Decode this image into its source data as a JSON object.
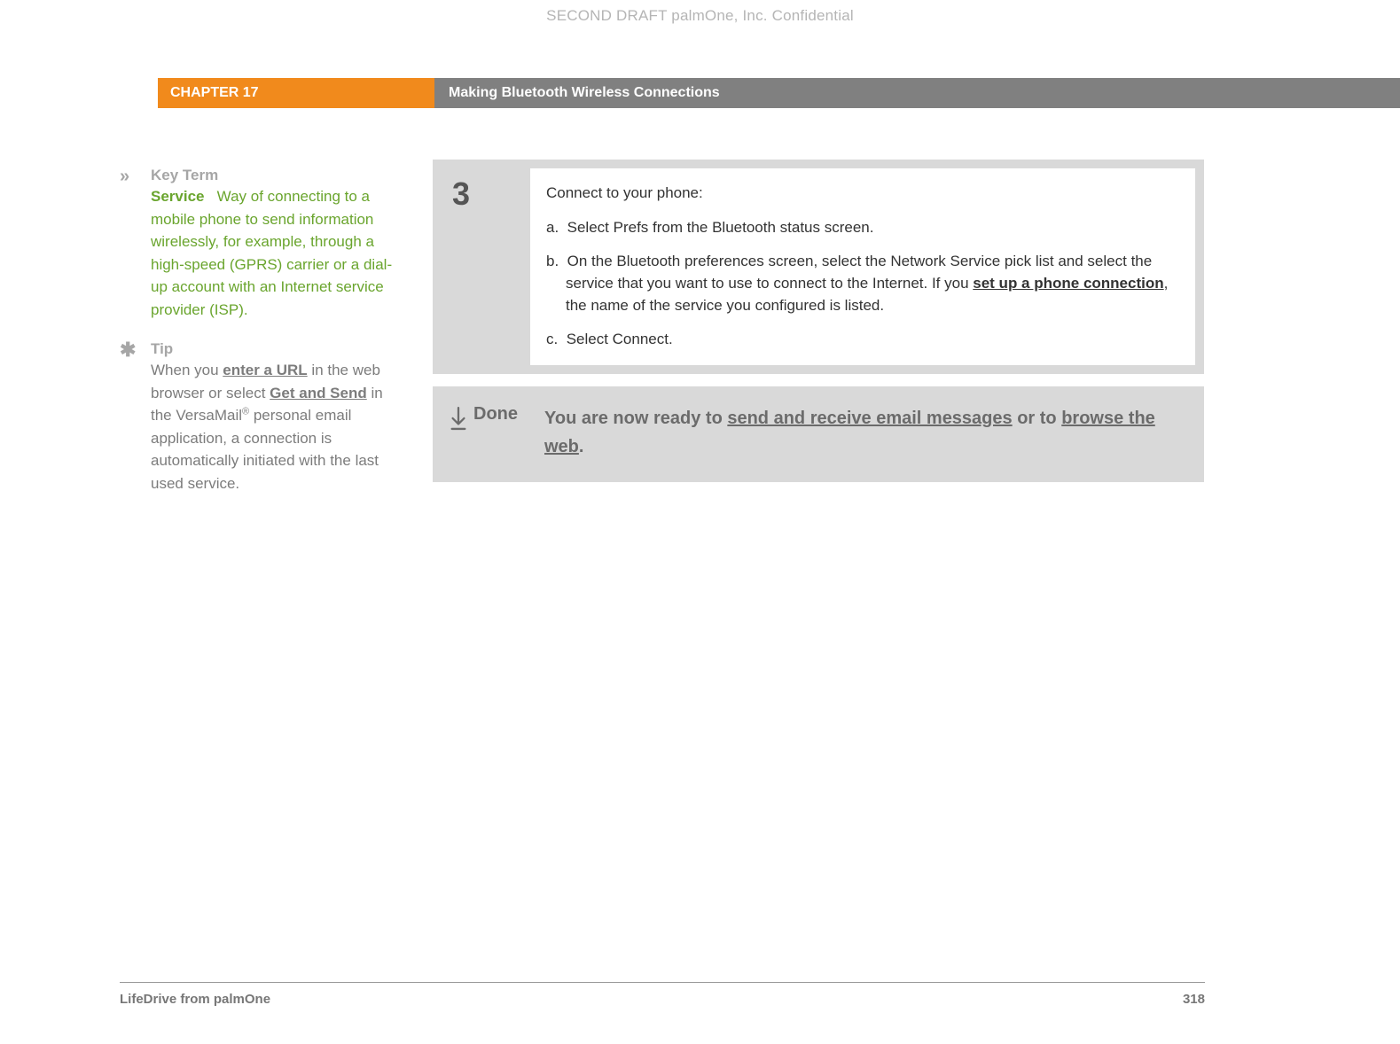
{
  "watermark": "SECOND DRAFT palmOne, Inc.  Confidential",
  "header": {
    "chapter": "CHAPTER 17",
    "title": "Making Bluetooth Wireless Connections"
  },
  "sidebar": {
    "keyterm": {
      "icon": "»",
      "heading": "Key Term",
      "term": "Service",
      "definition": "Way of connecting to a mobile phone to send information wirelessly, for example, through a high-speed (GPRS) carrier or a dial-up account with an Internet service provider (ISP)."
    },
    "tip": {
      "icon": "✱",
      "heading": "Tip",
      "pre": "When you ",
      "link1": "enter a URL",
      "mid1": " in the web browser or select ",
      "link2": "Get and Send",
      "mid2": " in the VersaMail",
      "sup": "®",
      "post": " personal email application, a connection is automatically initiated with the last used service."
    }
  },
  "step": {
    "number": "3",
    "intro": "Connect to your phone:",
    "a_label": "a.",
    "a_text": "Select Prefs from the Bluetooth status screen.",
    "b_label": "b.",
    "b_pre": "On the Bluetooth preferences screen, select the Network Service pick list and select the service that you want to use to connect to the Internet. If you ",
    "b_link": "set up a phone connection",
    "b_post": ", the name of the service you configured is listed.",
    "c_label": "c.",
    "c_text": "Select Connect."
  },
  "done": {
    "label": "Done",
    "pre": "You are now ready to ",
    "link1": "send and receive email messages",
    "mid": " or to ",
    "link2": "browse the web",
    "post": "."
  },
  "footer": {
    "product": "LifeDrive from palmOne",
    "page": "318"
  }
}
